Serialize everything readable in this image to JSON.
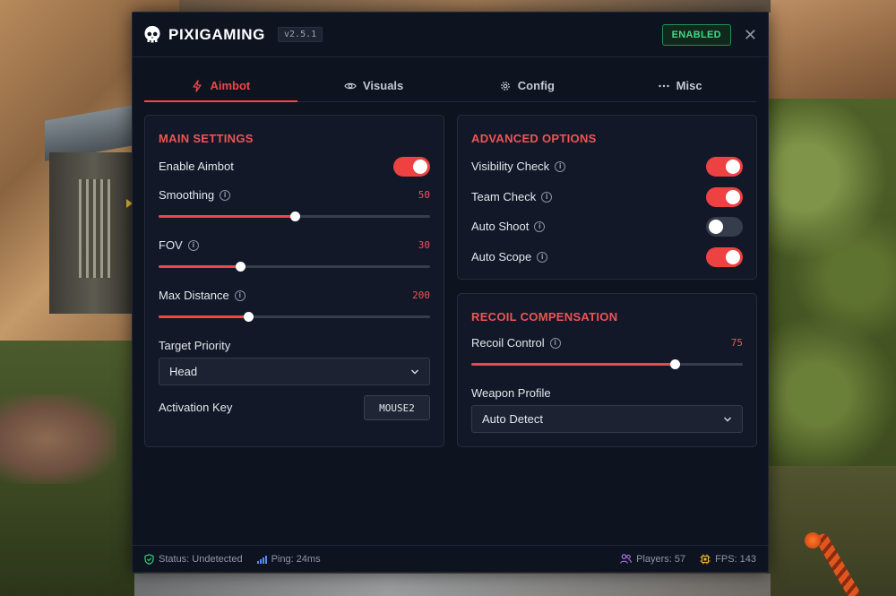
{
  "header": {
    "brand": "PIXIGAMING",
    "version": "v2.5.1",
    "status_badge": "ENABLED",
    "close_icon": "close-icon"
  },
  "tabs": [
    {
      "label": "Aimbot",
      "icon": "lightning-icon",
      "active": true
    },
    {
      "label": "Visuals",
      "icon": "eye-icon",
      "active": false
    },
    {
      "label": "Config",
      "icon": "gear-icon",
      "active": false
    },
    {
      "label": "Misc",
      "icon": "dots-icon",
      "active": false
    }
  ],
  "main_settings": {
    "title": "MAIN SETTINGS",
    "enable_aimbot": {
      "label": "Enable Aimbot",
      "on": true
    },
    "smoothing": {
      "label": "Smoothing",
      "value": "50",
      "fraction": 0.5
    },
    "fov": {
      "label": "FOV",
      "value": "30",
      "fraction": 0.3
    },
    "max_distance": {
      "label": "Max Distance",
      "value": "200",
      "fraction": 0.33
    },
    "target_priority": {
      "label": "Target Priority",
      "selected": "Head"
    },
    "activation_key": {
      "label": "Activation Key",
      "value": "MOUSE2"
    }
  },
  "advanced_options": {
    "title": "ADVANCED OPTIONS",
    "items": [
      {
        "label": "Visibility Check",
        "on": true
      },
      {
        "label": "Team Check",
        "on": true
      },
      {
        "label": "Auto Shoot",
        "on": false
      },
      {
        "label": "Auto Scope",
        "on": true
      }
    ]
  },
  "recoil": {
    "title": "RECOIL COMPENSATION",
    "recoil_control": {
      "label": "Recoil Control",
      "value": "75",
      "fraction": 0.75
    },
    "weapon_profile": {
      "label": "Weapon Profile",
      "selected": "Auto Detect"
    }
  },
  "statusbar": {
    "status": "Status: Undetected",
    "ping": "Ping: 24ms",
    "players": "Players: 57",
    "fps": "FPS: 143"
  },
  "colors": {
    "accent": "#ef4747",
    "enabled_green": "#3ddc84",
    "panel_bg": "#0e1320"
  }
}
